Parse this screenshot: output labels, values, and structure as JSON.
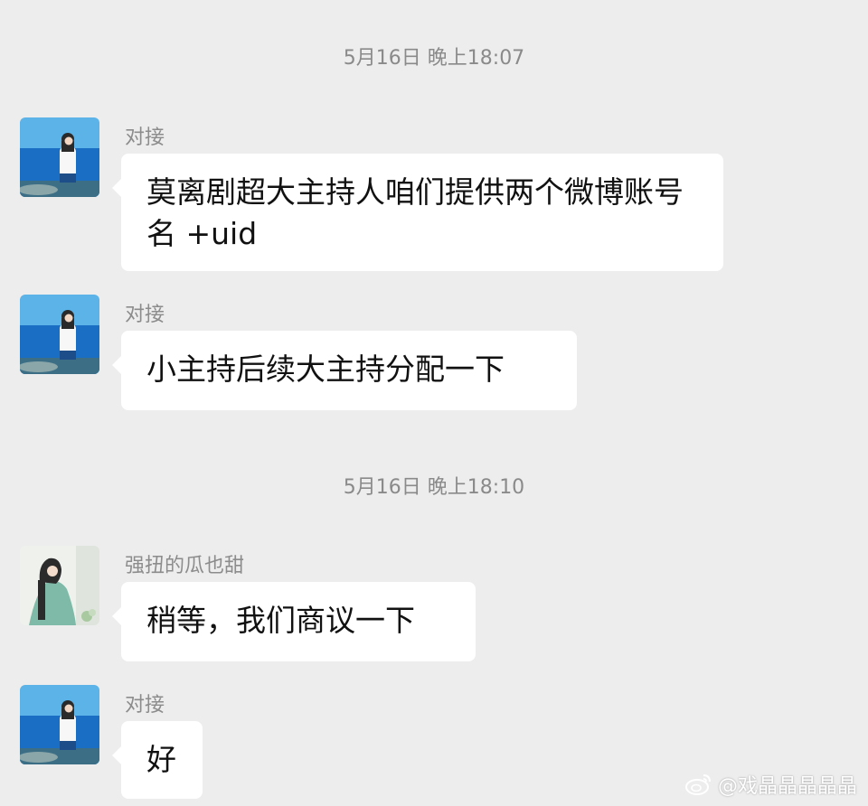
{
  "timestamps": [
    "5月16日 晚上18:07",
    "5月16日 晚上18:10"
  ],
  "messages": [
    {
      "sender": "对接",
      "text": "莫离剧超大主持人咱们提供两个微博账号名 +uid"
    },
    {
      "sender": "对接",
      "text": "小主持后续大主持分配一下"
    },
    {
      "sender": "强扭的瓜也甜",
      "text": "稍等，我们商议一下"
    },
    {
      "sender": "对接",
      "text": "好"
    }
  ],
  "watermark": {
    "text": "@戏晶晶晶晶晶",
    "icon": "weibo-logo-icon"
  },
  "colors": {
    "background": "#ededed",
    "bubble": "#ffffff",
    "sender": "#8c8c8c",
    "timestamp": "#8a8a8a",
    "text": "#111111"
  }
}
